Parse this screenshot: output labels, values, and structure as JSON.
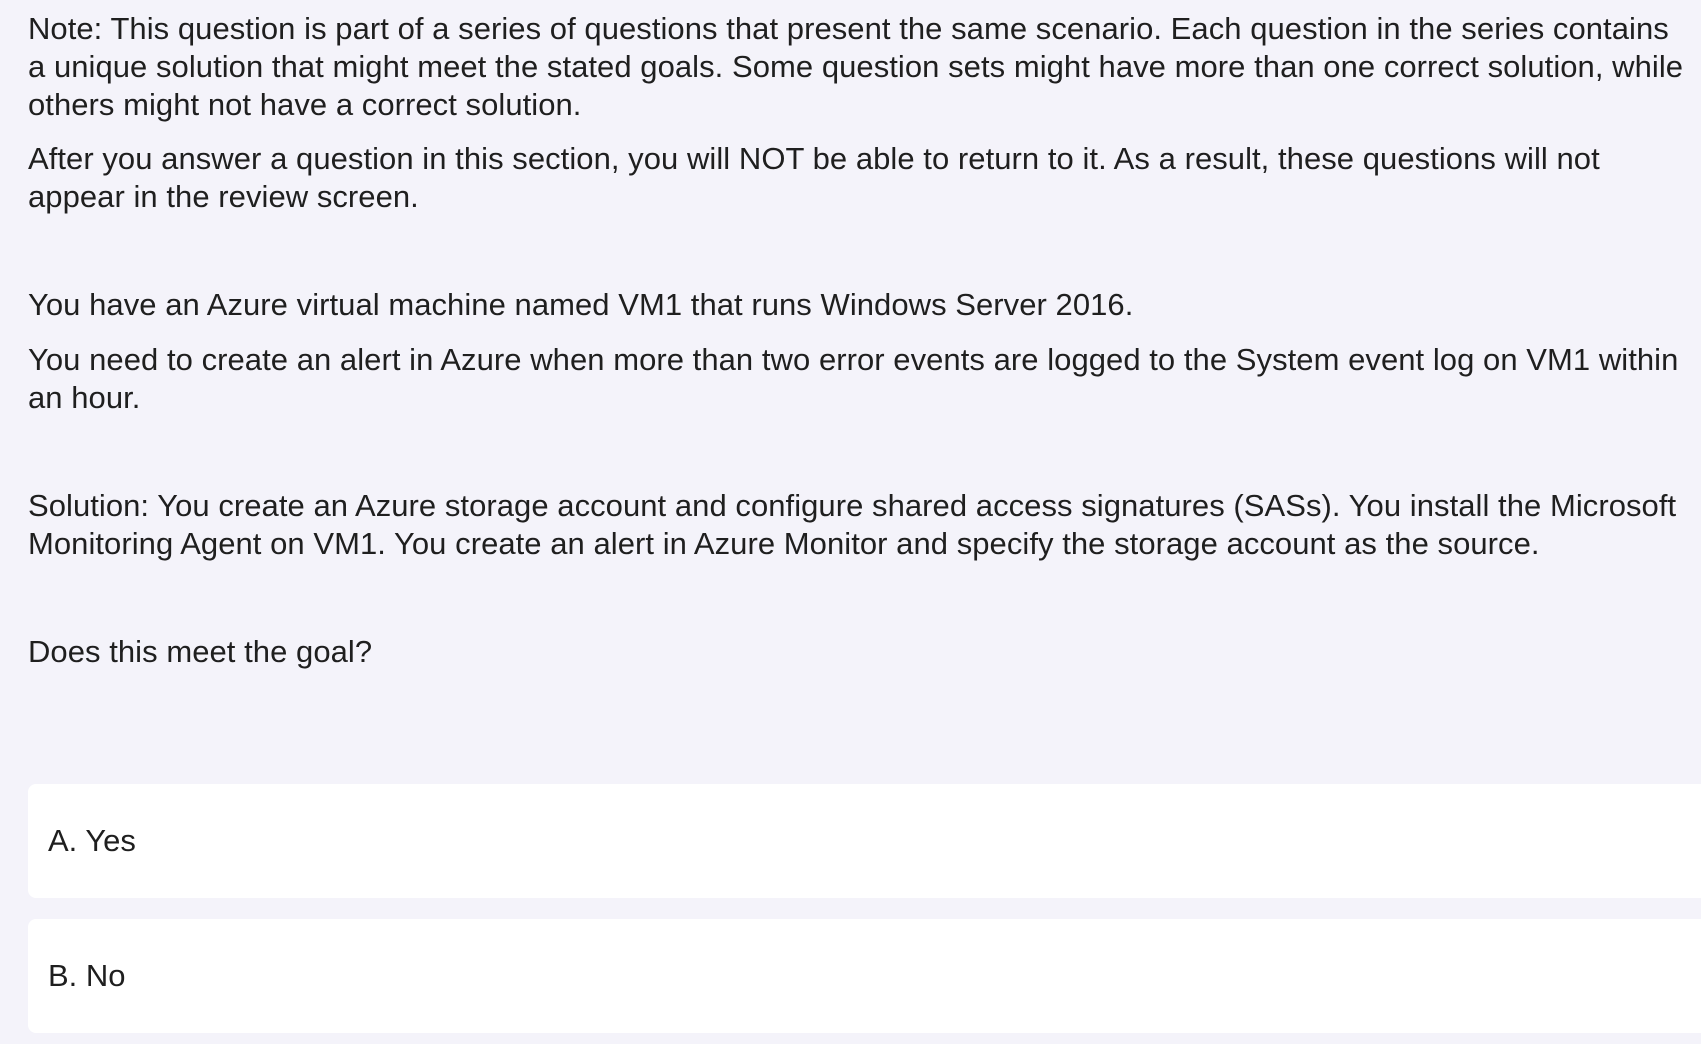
{
  "question": {
    "note": "Note: This question is part of a series of questions that present the same scenario. Each question in the series contains a unique solution that might meet the stated goals. Some question sets might have more than one correct solution, while others might not have a correct solution.",
    "after": "After you answer a question in this section, you will NOT be able to return to it. As a result, these questions will not appear in the review screen.",
    "scenario_vm": "You have an Azure virtual machine named VM1 that runs Windows Server 2016.",
    "scenario_need": "You need to create an alert in Azure when more than two error events are logged to the System event log on VM1 within an hour.",
    "solution": "Solution: You create an Azure storage account and configure shared access signatures (SASs). You install the Microsoft Monitoring Agent on VM1. You create an alert in Azure Monitor and specify the storage account as the source.",
    "prompt": "Does this meet the goal?"
  },
  "options": [
    {
      "label": "A. Yes"
    },
    {
      "label": "B. No"
    }
  ]
}
